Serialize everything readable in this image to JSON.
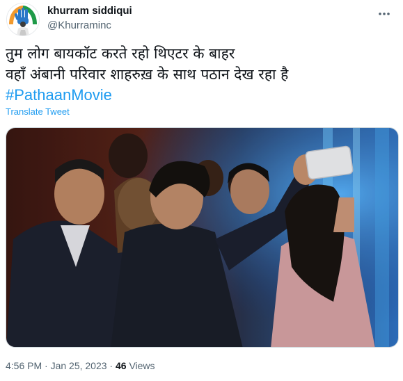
{
  "tweet": {
    "author": {
      "display_name": "khurram siddiqui",
      "handle": "@Khurraminc"
    },
    "text_lines": [
      "तुम लोग बायकॉट करते रहो थिएटर के बाहर",
      "वहाँ अंबानी परिवार शाहरुख़ के साथ पठान देख रहा है"
    ],
    "hashtag": "#PathaanMovie",
    "translate_label": "Translate Tweet",
    "timestamp": "4:56 PM · Jan 25, 2023 ·",
    "views_count": "46",
    "views_label": "Views"
  },
  "icons": {
    "more": "more-horizontal-icon",
    "avatar": "party-logo-avatar"
  },
  "colors": {
    "link": "#1d9bf0",
    "text": "#0f1419",
    "secondary": "#536471"
  }
}
